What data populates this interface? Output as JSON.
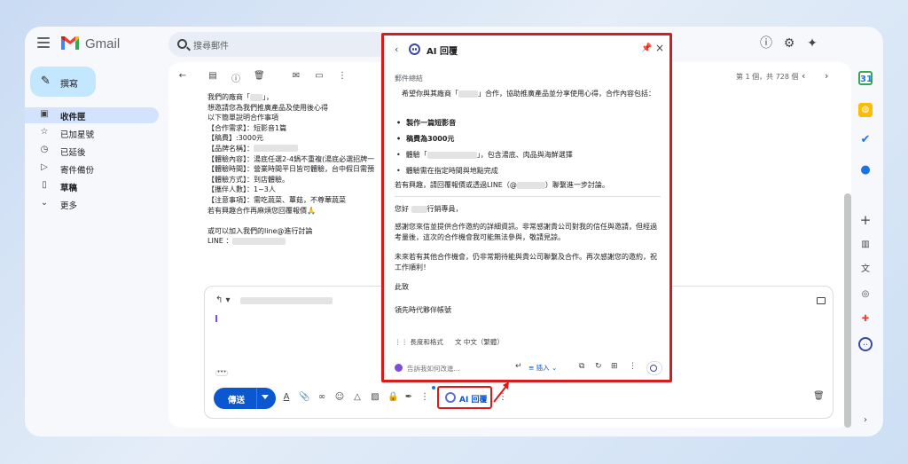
{
  "app": {
    "logo_text": "Gmail",
    "search_placeholder": "搜尋郵件"
  },
  "sidebar": {
    "compose_label": "撰寫",
    "items": [
      {
        "label": "收件匣",
        "icon": "inbox-icon"
      },
      {
        "label": "已加星號",
        "icon": "star-icon"
      },
      {
        "label": "已延後",
        "icon": "clock-icon"
      },
      {
        "label": "寄件備份",
        "icon": "send-icon"
      },
      {
        "label": "草稿",
        "icon": "draft-icon"
      },
      {
        "label": "更多",
        "icon": "chevron-down-icon"
      }
    ]
  },
  "mail": {
    "page_count": "第 1 個，共 728 個",
    "body_lines": [
      "我們的廠商「",
      "想邀請您為我們推廣產品及使用後心得",
      "以下簡單說明合作事項",
      "【合作需求】：短影音1篇",
      "【稿費】:3000元",
      "【品牌名稱】：",
      "【體驗內容】：湯底任選2-4鍋不重複(湯底必選招牌一",
      "【體驗時間】：營業時間平日皆可體驗，台中假日需預",
      "【體驗方式】：到店體驗。",
      "【攜伴人數】：1~3人",
      "【注意事項】：需吃蔬菜、蕈菇，不尊葷蔬菜",
      "若有興趣合作再麻煩您回覆報價🙏",
      "",
      "或可以加入我們的line@進行討論",
      "LINE ："
    ]
  },
  "reply": {
    "send_label": "傳送",
    "ai_button_label": "AI 回覆"
  },
  "ai_panel": {
    "title": "AI 回覆",
    "summary_heading": "郵件總結",
    "summary_intro_a": "　希望你與其廠商「",
    "summary_intro_b": "」合作，協助推廣產品並分享使用心得，合作內容包括：",
    "bullets": [
      {
        "text": "製作一篇短影音",
        "bold": true
      },
      {
        "text": "稿費為3000元",
        "bold": true
      },
      {
        "text": "體驗「",
        "suffix": "」，包含湯底、肉品與海鮮選擇",
        "bold": false
      },
      {
        "text": "體驗需在指定時間與地點完成",
        "bold": false
      }
    ],
    "summary_outro_a": "若有興趣，請回覆報價或透過LINE（@",
    "summary_outro_b": "）聯繫進一步討論。",
    "reply_greeting_a": "您好",
    "reply_greeting_b": "行銷專員，",
    "reply_p1": "感謝您來信並提供合作邀約的詳細資訊。非常感謝貴公司對我的信任與邀請，但經過考量後，這次的合作機會我可能無法參與，敬請見諒。",
    "reply_p2": "未來若有其他合作機會，仍非常期待能與貴公司聯繫及合作。再次感謝您的邀約，祝工作順利！",
    "reply_closing": "此致",
    "reply_signature": "領先時代夥伴帳號",
    "length_style": "長度和格式",
    "language": "中文（繁體）",
    "input_placeholder": "告訴我如何改進...",
    "insert_label": "插入"
  },
  "colors": {
    "highlight_red": "#d81b1b",
    "accent_blue": "#0b57d0",
    "compose_bg": "#c2e7ff",
    "active_nav_bg": "#d3e3fd"
  }
}
